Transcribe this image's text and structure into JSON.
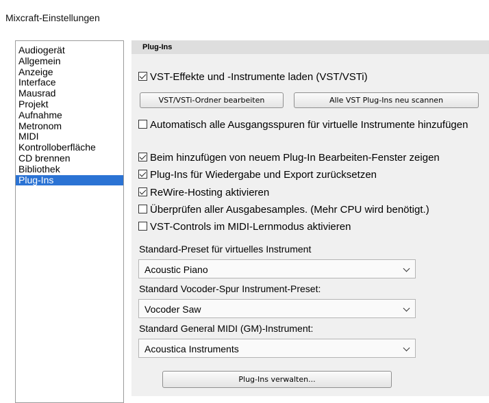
{
  "window": {
    "title": "Mixcraft-Einstellungen"
  },
  "sidebar": {
    "items": [
      {
        "label": "Audiogerät"
      },
      {
        "label": "Allgemein"
      },
      {
        "label": "Anzeige"
      },
      {
        "label": "Interface"
      },
      {
        "label": "Mausrad"
      },
      {
        "label": "Projekt"
      },
      {
        "label": "Aufnahme"
      },
      {
        "label": "Metronom"
      },
      {
        "label": "MIDI"
      },
      {
        "label": "Kontrolloberfläche"
      },
      {
        "label": "CD brennen"
      },
      {
        "label": "Bibliothek"
      },
      {
        "label": "Plug-Ins",
        "selected": true
      }
    ]
  },
  "panel": {
    "title": "Plug-Ins",
    "options": {
      "load_vst": {
        "label": "VST-Effekte und -Instrumente laden (VST/VSTi)",
        "checked": true
      },
      "auto_output_tracks": {
        "label": "Automatisch alle Ausgangsspuren für virtuelle Instrumente hinzufügen",
        "checked": false
      },
      "show_edit_window": {
        "label": "Beim hinzufügen von neuem Plug-In Bearbeiten-Fenster zeigen",
        "checked": true
      },
      "reset_plugins": {
        "label": "Plug-Ins für Wiedergabe und Export zurücksetzen",
        "checked": true
      },
      "rewire_hosting": {
        "label": "ReWire-Hosting aktivieren",
        "checked": true
      },
      "check_output_samples": {
        "label": "Überprüfen aller Ausgabesamples. (Mehr CPU wird benötigt.)",
        "checked": false
      },
      "vst_midi_learn": {
        "label": "VST-Controls im MIDI-Lernmodus aktivieren",
        "checked": false
      }
    },
    "buttons": {
      "edit_folders": "VST/VSTi-Ordner bearbeiten",
      "rescan": "Alle VST Plug-Ins neu scannen",
      "manage": "Plug-Ins verwalten..."
    },
    "dropdowns": {
      "instrument_preset": {
        "label": "Standard-Preset für virtuelles Instrument",
        "value": "Acoustic Piano"
      },
      "vocoder_preset": {
        "label": "Standard Vocoder-Spur Instrument-Preset:",
        "value": "Vocoder Saw"
      },
      "gm_instrument": {
        "label": "Standard General MIDI (GM)-Instrument:",
        "value": "Acoustica Instruments"
      }
    }
  }
}
